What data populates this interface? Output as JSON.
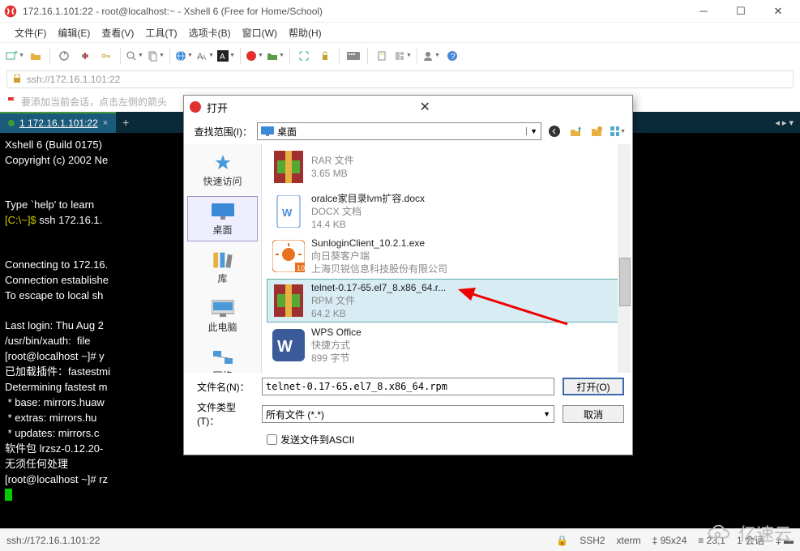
{
  "titlebar": {
    "text": "172.16.1.101:22 - root@localhost:~ - Xshell 6 (Free for Home/School)"
  },
  "menu": [
    "文件(F)",
    "编辑(E)",
    "查看(V)",
    "工具(T)",
    "选项卡(B)",
    "窗口(W)",
    "帮助(H)"
  ],
  "address": "ssh://172.16.1.101:22",
  "tip": "要添加当前会话，点击左侧的箭头",
  "tab": {
    "label": "1 172.16.1.101:22"
  },
  "terminal": {
    "l1": "Xshell 6 (Build 0175)",
    "l2": "Copyright (c) 2002 Ne",
    "l3": "Type `help' to learn ",
    "l4a": "[C:\\~]$ ",
    "l4b": "ssh 172.16.1.",
    "l5": "Connecting to 172.16.",
    "l6": "Connection establishe",
    "l7": "To escape to local sh",
    "l8": "Last login: Thu Aug 2",
    "l9": "/usr/bin/xauth:  file",
    "l10": "[root@localhost ~]# y",
    "l11": "已加载插件：fastestmi",
    "l12": "Determining fastest m",
    "l13": " * base: mirrors.huaw",
    "l14": " * extras: mirrors.hu",
    "l15": " * updates: mirrors.c",
    "l16": "软件包 lrzsz-0.12.20-",
    "l17": "无须任何处理",
    "l18": "[root@localhost ~]# rz"
  },
  "footer": {
    "left": "ssh://172.16.1.101:22",
    "ssh": "SSH2",
    "term": "xterm",
    "size": "95x24",
    "pos": "23,1",
    "sess": "1 会话"
  },
  "watermark": "亿速云",
  "dialog": {
    "title": "打开",
    "scope_label": "查找范围(I)：",
    "scope_value": "桌面",
    "places": [
      {
        "label": "快速访问",
        "icon": "star"
      },
      {
        "label": "桌面",
        "icon": "desktop",
        "selected": true
      },
      {
        "label": "库",
        "icon": "library"
      },
      {
        "label": "此电脑",
        "icon": "computer"
      },
      {
        "label": "网络",
        "icon": "network"
      }
    ],
    "files": [
      {
        "name": "",
        "kind": "RAR 文件",
        "size": "3.65 MB",
        "icon": "rar"
      },
      {
        "name": "oralce家目录lvm扩容.docx",
        "kind": "DOCX 文档",
        "size": "14.4 KB",
        "icon": "docx"
      },
      {
        "name": "SunloginClient_10.2.1.exe",
        "kind": "向日葵客户端",
        "size": "上海贝锐信息科技股份有限公司",
        "icon": "sun"
      },
      {
        "name": "telnet-0.17-65.el7_8.x86_64.r...",
        "kind": "RPM 文件",
        "size": "64.2 KB",
        "icon": "rar",
        "selected": true
      },
      {
        "name": "WPS Office",
        "kind": "快捷方式",
        "size": "899 字节",
        "icon": "wps"
      }
    ],
    "filename_label": "文件名(N)：",
    "filename_value": "telnet-0.17-65.el7_8.x86_64.rpm",
    "filetype_label": "文件类型(T)：",
    "filetype_value": "所有文件 (*.*)",
    "open_btn": "打开(O)",
    "cancel_btn": "取消",
    "ascii_check": "发送文件到ASCII"
  }
}
